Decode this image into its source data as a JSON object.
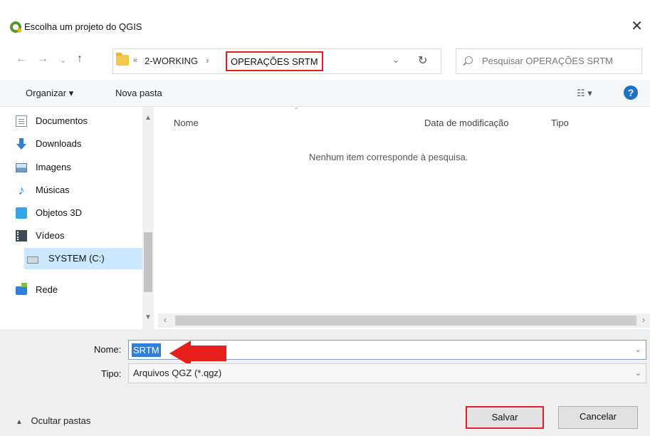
{
  "window": {
    "title": "Escolha um projeto do QGIS"
  },
  "address": {
    "overflow": "«",
    "crumb1": "2-WORKING",
    "separator": "›",
    "crumb2": "OPERAÇÕES SRTM",
    "dropdown": "⌄",
    "refresh": "↻"
  },
  "search": {
    "placeholder": "Pesquisar OPERAÇÕES SRTM"
  },
  "toolbar": {
    "organize": "Organizar ▾",
    "new_folder": "Nova pasta",
    "view": "☷ ▾",
    "help": "?"
  },
  "sidebar": {
    "items": [
      {
        "label": "Documentos",
        "icon": "documents-icon"
      },
      {
        "label": "Downloads",
        "icon": "downloads-icon"
      },
      {
        "label": "Imagens",
        "icon": "images-icon"
      },
      {
        "label": "Músicas",
        "icon": "music-icon"
      },
      {
        "label": "Objetos 3D",
        "icon": "objects-3d-icon"
      },
      {
        "label": "Vídeos",
        "icon": "videos-icon"
      },
      {
        "label": "SYSTEM (C:)",
        "icon": "drive-icon",
        "selected": true
      },
      {
        "label": "Rede",
        "icon": "network-icon"
      }
    ]
  },
  "columns": {
    "name": "Nome",
    "date": "Data de modificação",
    "type": "Tipo"
  },
  "content": {
    "empty_message": "Nenhum item corresponde à pesquisa."
  },
  "form": {
    "name_label": "Nome:",
    "name_value": "SRTM",
    "type_label": "Tipo:",
    "type_value": "Arquivos QGZ (*.qgz)"
  },
  "footer": {
    "hide_folders": "Ocultar pastas",
    "save": "Salvar",
    "cancel": "Cancelar"
  },
  "colors": {
    "highlight": "#e02020",
    "selection": "#2f7fd6",
    "accent": "#cce8ff"
  }
}
